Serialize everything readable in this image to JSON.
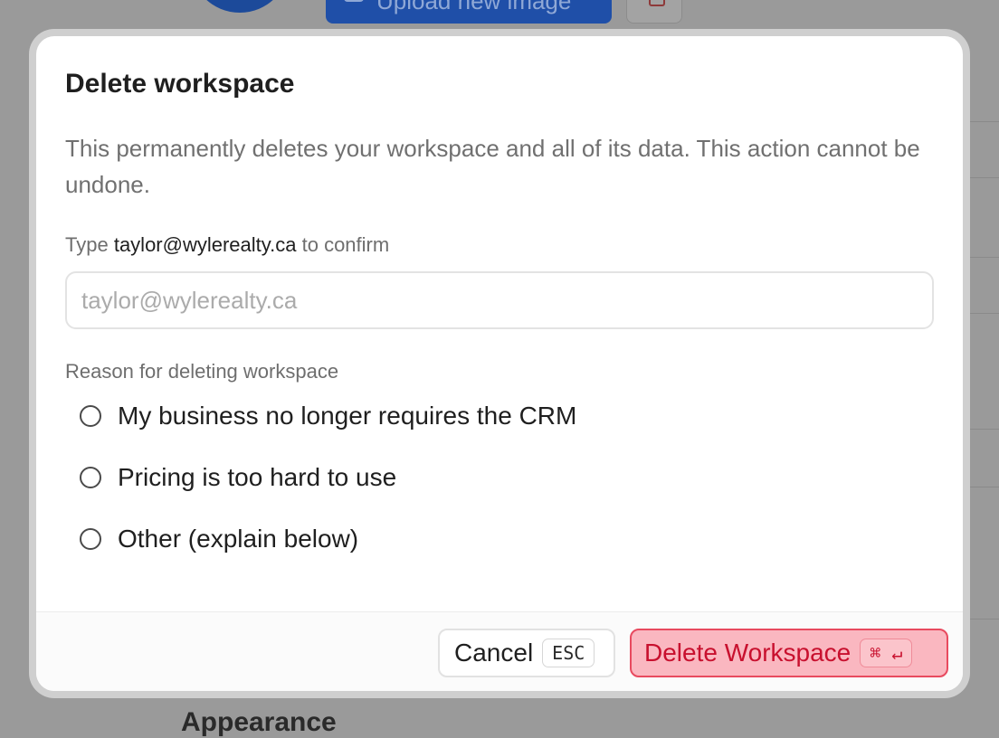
{
  "background": {
    "upload_button_label": "Upload new image",
    "section_heading": "Appearance"
  },
  "dialog": {
    "title": "Delete workspace",
    "description": "This permanently deletes your workspace and all of its data. This action cannot be undone.",
    "confirm_prefix": "Type",
    "confirm_email": "taylor@wylerealty.ca",
    "confirm_suffix": "to confirm",
    "confirm_input": {
      "value": "",
      "placeholder": "taylor@wylerealty.ca"
    },
    "reason_label": "Reason for deleting workspace",
    "reasons": [
      {
        "label": "My business no longer requires the CRM",
        "selected": false
      },
      {
        "label": "Pricing is too hard to use",
        "selected": false
      },
      {
        "label": "Other (explain below)",
        "selected": false
      }
    ],
    "cancel_button": {
      "label": "Cancel",
      "shortcut": "ESC"
    },
    "delete_button": {
      "label": "Delete Workspace",
      "shortcut": "⌘ ↵"
    }
  },
  "colors": {
    "danger_text": "#c8102e",
    "danger_bg": "#fab7c0",
    "danger_border": "#e84a5f",
    "overlay": "#9a9a9a"
  },
  "icons": [
    "image-icon",
    "trash-icon",
    "chevron-left-icon",
    "command-icon",
    "enter-icon"
  ]
}
